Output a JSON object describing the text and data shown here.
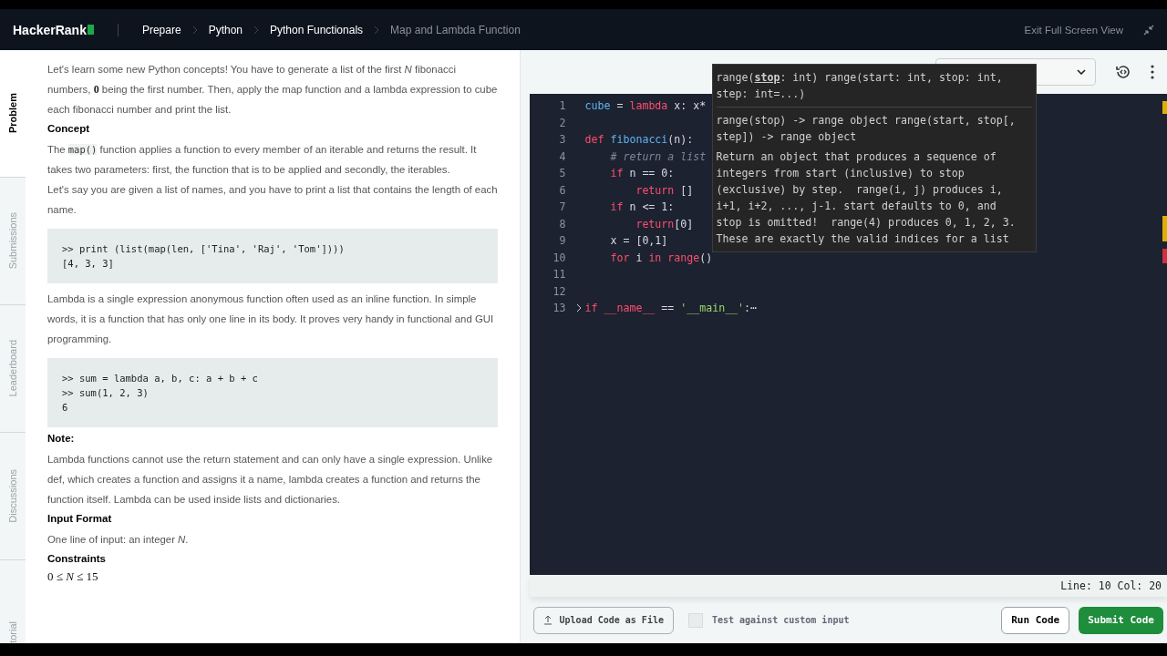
{
  "nav": {
    "logo": "HackerRank",
    "breadcrumbs": [
      {
        "label": "Prepare",
        "current": false
      },
      {
        "label": "Python",
        "current": false
      },
      {
        "label": "Python Functionals",
        "current": false
      },
      {
        "label": "Map and Lambda Function",
        "current": true
      }
    ],
    "exit": "Exit Full Screen View"
  },
  "side_tabs": [
    {
      "label": "Problem",
      "selected": true
    },
    {
      "label": "Submissions",
      "selected": false
    },
    {
      "label": "Leaderboard",
      "selected": false
    },
    {
      "label": "Discussions",
      "selected": false
    },
    {
      "label": "torial",
      "selected": false
    }
  ],
  "problem": [
    {
      "kind": "para",
      "text": "Let's learn some new Python concepts! You have to generate a list of the first *N* fibonacci numbers, **0** being the first number. Then, apply the map function and a lambda expression to cube each fibonacci number and print the list."
    },
    {
      "kind": "heading",
      "text": "Concept"
    },
    {
      "kind": "runs",
      "runs": [
        {
          "kind": "text",
          "text": "The "
        },
        {
          "kind": "code",
          "text": "map()"
        },
        {
          "kind": "text",
          "text": " function applies a function to every member of an iterable and returns the result. It takes two parameters: first, the function that is to be applied and secondly, the iterables."
        }
      ]
    },
    {
      "kind": "para",
      "text": "Let's say you are given a list of names, and you have to print a list that contains the length of each name."
    },
    {
      "kind": "code",
      "lines": [
        ">> print (list(map(len, ['Tina', 'Raj', 'Tom'])))",
        "[4, 3, 3]"
      ]
    },
    {
      "kind": "para",
      "text": "Lambda is a single expression anonymous function often used as an inline function. In simple words, it is a function that has only one line in its body. It proves very handy in functional and GUI programming."
    },
    {
      "kind": "code",
      "lines": [
        ">> sum = lambda a, b, c: a + b + c",
        ">> sum(1, 2, 3)",
        "6"
      ]
    },
    {
      "kind": "heading",
      "text": "Note:"
    },
    {
      "kind": "para",
      "text": "Lambda functions cannot use the return statement and can only have a single expression. Unlike def, which creates a function and assigns it a name, lambda creates a function and returns the function itself. Lambda can be used inside lists and dictionaries."
    },
    {
      "kind": "heading",
      "text": "Input Format"
    },
    {
      "kind": "para",
      "text": "One line of input: an integer *N*."
    },
    {
      "kind": "heading",
      "text": "Constraints"
    },
    {
      "kind": "math",
      "text": "0 ≤ *N* ≤ 15"
    }
  ],
  "editor": {
    "lines": [
      {
        "number": "1",
        "segments": [
          {
            "kind": "name",
            "text": "cube"
          },
          {
            "kind": "plain",
            "text": " = "
          },
          {
            "kind": "keyword",
            "text": "lambda"
          },
          {
            "kind": "plain",
            "text": " x: x*"
          }
        ]
      },
      {
        "number": "2"
      },
      {
        "number": "3",
        "segments": [
          {
            "kind": "keyword",
            "text": "def"
          },
          {
            "kind": "name",
            "text": " fibonacci"
          },
          {
            "kind": "plain",
            "text": "(n):"
          }
        ]
      },
      {
        "number": "4",
        "segments": [
          {
            "kind": "comment",
            "text": "    # return a list"
          }
        ]
      },
      {
        "number": "5",
        "segments": [
          {
            "kind": "keyword",
            "text": "    if"
          },
          {
            "kind": "plain",
            "text": " n == 0:"
          }
        ]
      },
      {
        "number": "6",
        "segments": [
          {
            "kind": "keyword",
            "text": "        return"
          },
          {
            "kind": "plain",
            "text": " []"
          }
        ]
      },
      {
        "number": "7",
        "segments": [
          {
            "kind": "keyword",
            "text": "    if"
          },
          {
            "kind": "plain",
            "text": " n <= 1:"
          }
        ]
      },
      {
        "number": "8",
        "segments": [
          {
            "kind": "keyword",
            "text": "        return"
          },
          {
            "kind": "plain",
            "text": "[0]"
          }
        ]
      },
      {
        "number": "9",
        "segments": [
          {
            "kind": "plain",
            "text": "    x = [0,1]"
          }
        ]
      },
      {
        "number": "10",
        "segments": [
          {
            "kind": "keyword",
            "text": "    for"
          },
          {
            "kind": "plain",
            "text": " i "
          },
          {
            "kind": "keyword",
            "text": "in"
          },
          {
            "kind": "keyword",
            "text": " range"
          },
          {
            "kind": "plain",
            "text": "()"
          }
        ]
      },
      {
        "number": "11"
      },
      {
        "number": "12"
      },
      {
        "number": "13",
        "folded": true,
        "segments": [
          {
            "kind": "keyword",
            "text": "if"
          },
          {
            "kind": "keyword",
            "text": " __name__"
          },
          {
            "kind": "plain",
            "text": " == "
          },
          {
            "kind": "string",
            "text": "'__main__'"
          },
          {
            "kind": "plain",
            "text": ":⋯"
          }
        ]
      }
    ],
    "tooltip": {
      "signature": [
        "range(**stop**: int) range(start: int, stop: int,",
        "step: int=...)"
      ],
      "doc": [
        "range(stop) -> range object range(start, stop[,",
        "step]) -> range object"
      ],
      "description": [
        "Return an object that produces a sequence of",
        "integers from start (inclusive) to stop",
        "(exclusive) by step.  range(i, j) produces i,",
        "i+1, i+2, ..., j-1. start defaults to 0, and",
        "stop is omitted!  range(4) produces 0, 1, 2, 3.",
        "These are exactly the valid indices for a list"
      ]
    },
    "status": "Line: 10 Col: 20"
  },
  "footer": {
    "upload": "Upload Code as File",
    "custom_input": {
      "label": "Test against custom input",
      "checked": false
    },
    "run": "Run Code",
    "submit": "Submit Code"
  }
}
